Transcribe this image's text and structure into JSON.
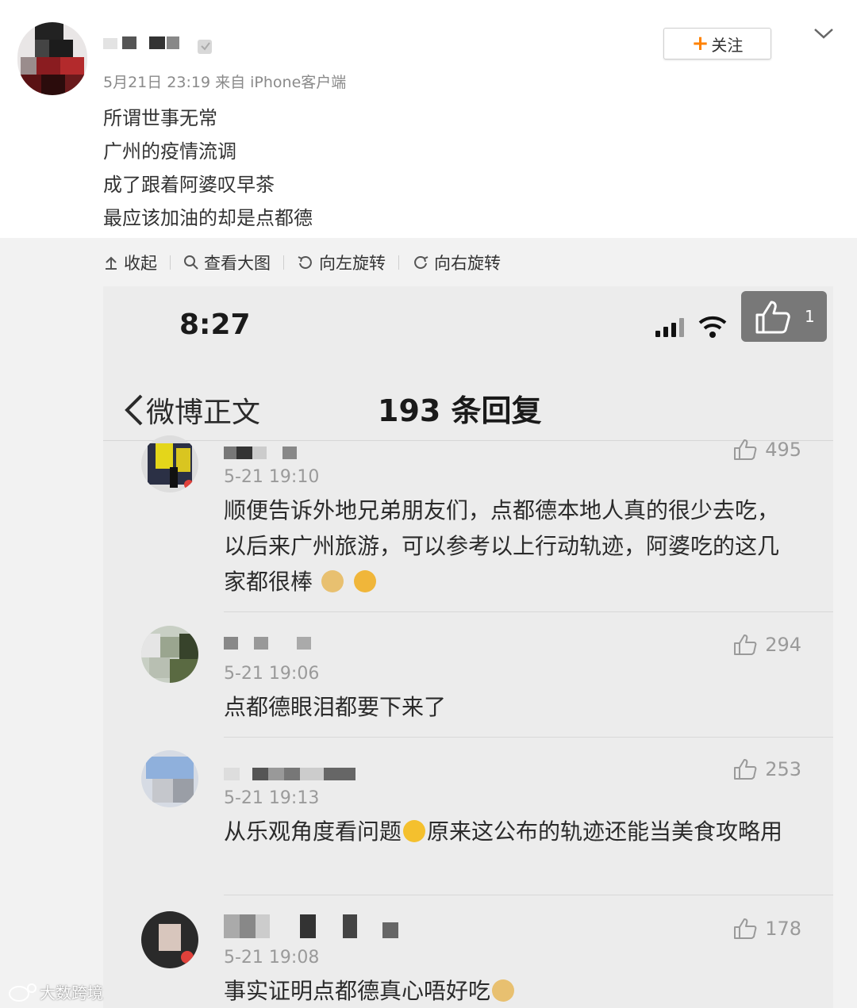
{
  "post": {
    "meta": "5月21日 23:19 来自 iPhone客户端",
    "lines": [
      "所谓世事无常",
      "广州的疫情流调",
      "成了跟着阿婆叹早茶",
      "最应该加油的却是点都德"
    ],
    "follow_label": "关注",
    "follow_plus": "+"
  },
  "toolbar": {
    "collapse": "收起",
    "view_large": "查看大图",
    "rotate_left": "向左旋转",
    "rotate_right": "向右旋转"
  },
  "screenshot": {
    "status_time": "8:27",
    "like_count": "1",
    "back_label": "微博正文",
    "title": "193 条回复",
    "comments": [
      {
        "time": "5-21 19:10",
        "likes": "495",
        "text": "顺便告诉外地兄弟朋友们，点都德本地人真的很少去吃，以后来广州旅游，可以参考以上行动轨迹，阿婆吃的这几家都很棒"
      },
      {
        "time": "5-21 19:06",
        "likes": "294",
        "text": "点都德眼泪都要下来了"
      },
      {
        "time": "5-21 19:13",
        "likes": "253",
        "text_a": "从乐观角度看问题",
        "text_b": "原来这公布的轨迹还能当美食攻略用"
      },
      {
        "time": "5-21 19:08",
        "likes": "178",
        "text": "事实证明点都德真心唔好吃"
      }
    ]
  },
  "watermark": "大数跨境",
  "colors": {
    "accent": "#ff8200",
    "muted": "#9a9a9a"
  }
}
